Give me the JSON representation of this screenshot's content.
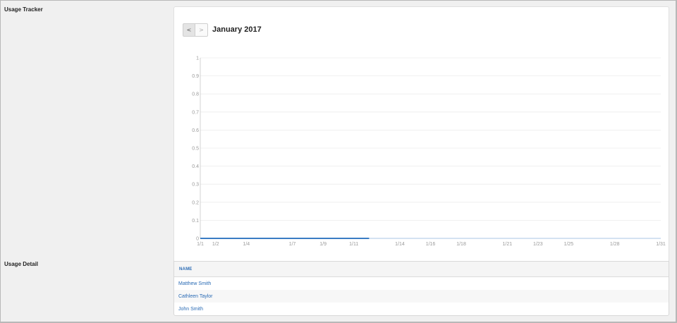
{
  "sections": {
    "tracker_label": "Usage Tracker",
    "detail_label": "Usage Detail"
  },
  "nav": {
    "prev_label": "<",
    "next_label": ">",
    "month_title": "January 2017"
  },
  "chart_data": {
    "type": "line",
    "x": [
      "1/1",
      "1/2",
      "1/4",
      "1/7",
      "1/9",
      "1/11",
      "1/14",
      "1/16",
      "1/18",
      "1/21",
      "1/23",
      "1/25",
      "1/28",
      "1/31"
    ],
    "y_ticks": [
      "1",
      "0.9",
      "0.8",
      "0.7",
      "0.6",
      "0.5",
      "0.4",
      "0.3",
      "0.2",
      "0.1",
      "0"
    ],
    "ylim": [
      0,
      1
    ],
    "series": [
      {
        "values": [
          0,
          0,
          0,
          0,
          0,
          0
        ],
        "x_range": [
          "1/1",
          "1/12"
        ],
        "color": "#3a7cc4"
      }
    ],
    "baseline_color": "#a8c4e4",
    "grid": true,
    "title": "",
    "xlabel": "",
    "ylabel": ""
  },
  "table": {
    "header": "NAME",
    "rows": [
      "Matthew Smith",
      "Cathleen Taylor",
      "John Smith"
    ]
  }
}
